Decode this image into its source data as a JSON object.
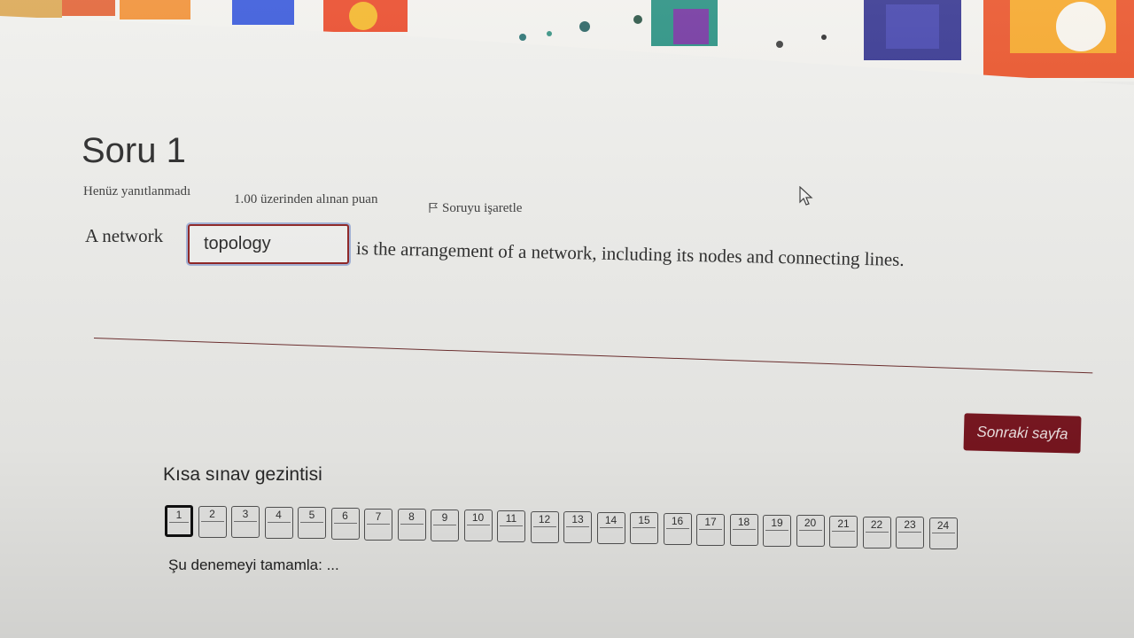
{
  "question": {
    "title": "Soru 1",
    "status": "Henüz yanıtlanmadı",
    "points": "1.00 üzerinden alınan puan",
    "flag_label": "Soruyu işaretle",
    "text_before": "A network",
    "answer_value": "topology",
    "text_after": "is the arrangement of a network, including its nodes and connecting lines."
  },
  "next_button": "Sonraki sayfa",
  "navigation": {
    "title": "Kısa sınav gezintisi",
    "items": [
      "1",
      "2",
      "3",
      "4",
      "5",
      "6",
      "7",
      "8",
      "9",
      "10",
      "11",
      "12",
      "13",
      "14",
      "15",
      "16",
      "17",
      "18",
      "19",
      "20",
      "21",
      "22",
      "23",
      "24"
    ],
    "current": "1",
    "finish_link": "Şu denemeyi tamamla: ..."
  },
  "colors": {
    "accent": "#7a1620",
    "input_border": "#8b1a1a",
    "focus_ring": "#9fb0d8"
  },
  "icons": [
    "flag-icon",
    "mouse-cursor-icon"
  ]
}
